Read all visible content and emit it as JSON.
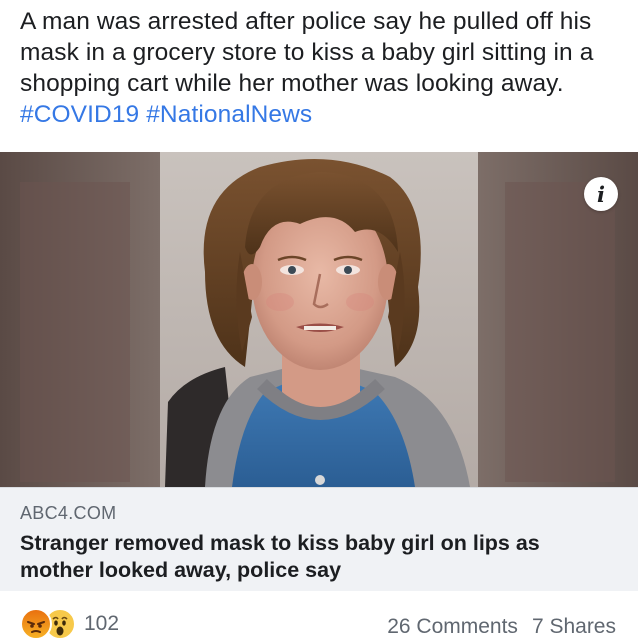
{
  "post": {
    "text_lines": [
      "A man was arrested after police say he pulled off his",
      "mask in a grocery store to kiss a baby girl sitting in a",
      "shopping cart while her mother was looking away."
    ],
    "hashtags": [
      "#COVID19",
      "#NationalNews"
    ]
  },
  "media": {
    "info_icon": "info-icon"
  },
  "link_preview": {
    "domain": "ABC4.COM",
    "title_lines": [
      "Stranger removed mask to kiss baby girl on lips as",
      "mother looked away, police say"
    ]
  },
  "footer": {
    "reaction_icons": [
      "angry-reaction-icon",
      "wow-reaction-icon"
    ],
    "reaction_count": "102",
    "comments": "26 Comments",
    "shares": "7 Shares"
  },
  "colors": {
    "hashtag": "#3578e5",
    "text": "#1c1e21",
    "secondary_text": "#606770",
    "link_card_bg": "#f0f2f5"
  }
}
